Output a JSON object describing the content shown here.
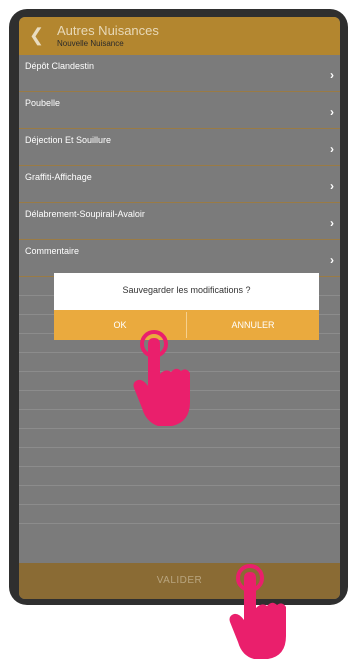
{
  "header": {
    "back_icon": "chevron-left-icon",
    "title": "Autres Nuisances",
    "subtitle": "Nouvelle Nuisance"
  },
  "list": {
    "items": [
      {
        "label": "Dépôt Clandestin"
      },
      {
        "label": "Poubelle"
      },
      {
        "label": "Déjection Et Souillure"
      },
      {
        "label": "Graffiti-Affichage"
      },
      {
        "label": "Délabrement-Soupirail-Avaloir"
      },
      {
        "label": "Commentaire"
      }
    ],
    "chevron": "›"
  },
  "dialog": {
    "message": "Sauvegarder les modifications ?",
    "ok_label": "OK",
    "cancel_label": "ANNULER"
  },
  "footer": {
    "validate_label": "VALIDER"
  },
  "colors": {
    "accent": "#b3862f",
    "dialog_button": "#eaaa3e",
    "overlay": "#7b7b7b",
    "hand": "#ea1f6c"
  },
  "icons": {
    "tap_hand_1": "pointing-hand-icon",
    "tap_hand_2": "pointing-hand-icon"
  }
}
